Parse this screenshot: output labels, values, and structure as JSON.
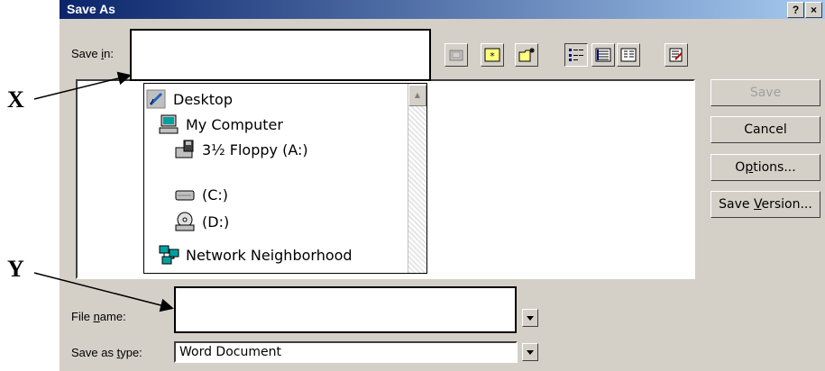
{
  "window": {
    "title": "Save As",
    "help_btn": "?",
    "close_btn": "×"
  },
  "save_in": {
    "label_pre": "Save ",
    "label_u": "i",
    "label_post": "n:",
    "value": ""
  },
  "toolbar": {
    "icons": [
      "up-one-level-icon",
      "search-web-icon",
      "new-folder-icon",
      "list-view-icon",
      "details-view-icon",
      "properties-view-icon",
      "tools-icon"
    ]
  },
  "locations": [
    {
      "label": "Desktop",
      "icon": "desktop-icon"
    },
    {
      "label": "My Computer",
      "icon": "computer-icon"
    },
    {
      "label": "3½ Floppy (A:)",
      "icon": "floppy-icon"
    },
    {
      "label": "(C:)",
      "icon": "hard-drive-icon"
    },
    {
      "label": "(D:)",
      "icon": "cd-drive-icon"
    },
    {
      "label": "Network Neighborhood",
      "icon": "network-icon"
    }
  ],
  "buttons": {
    "save": "Save",
    "cancel": "Cancel",
    "options_pre": "O",
    "options_u": "p",
    "options_post": "tions...",
    "version_pre": "Save ",
    "version_u": "V",
    "version_post": "ersion..."
  },
  "file_name": {
    "label_pre": "File ",
    "label_u": "n",
    "label_post": "ame:",
    "value": ""
  },
  "save_type": {
    "label_pre": "Save as ",
    "label_u": "t",
    "label_post": "ype:",
    "value": "Word Document"
  },
  "annotations": {
    "x": "X",
    "y": "Y"
  }
}
